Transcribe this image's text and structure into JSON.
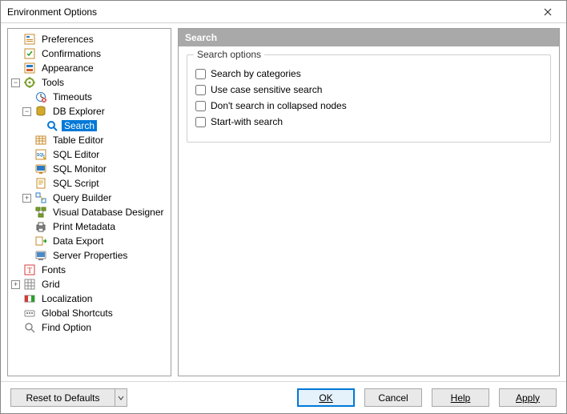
{
  "window": {
    "title": "Environment Options"
  },
  "tree": {
    "preferences": "Preferences",
    "confirmations": "Confirmations",
    "appearance": "Appearance",
    "tools": "Tools",
    "timeouts": "Timeouts",
    "db_explorer": "DB Explorer",
    "search": "Search",
    "table_editor": "Table Editor",
    "sql_editor": "SQL Editor",
    "sql_monitor": "SQL Monitor",
    "sql_script": "SQL Script",
    "query_builder": "Query Builder",
    "visual_db_designer": "Visual Database Designer",
    "print_metadata": "Print Metadata",
    "data_export": "Data Export",
    "server_properties": "Server Properties",
    "fonts": "Fonts",
    "grid": "Grid",
    "localization": "Localization",
    "global_shortcuts": "Global Shortcuts",
    "find_option": "Find Option"
  },
  "panel": {
    "header": "Search",
    "group_title": "Search options",
    "opt_by_categories": "Search by categories",
    "opt_case_sensitive": "Use case sensitive search",
    "opt_no_collapsed": "Don't search in collapsed nodes",
    "opt_start_with": "Start-with search"
  },
  "footer": {
    "reset": "Reset to Defaults",
    "ok": "OK",
    "cancel": "Cancel",
    "help": "Help",
    "apply": "Apply"
  }
}
